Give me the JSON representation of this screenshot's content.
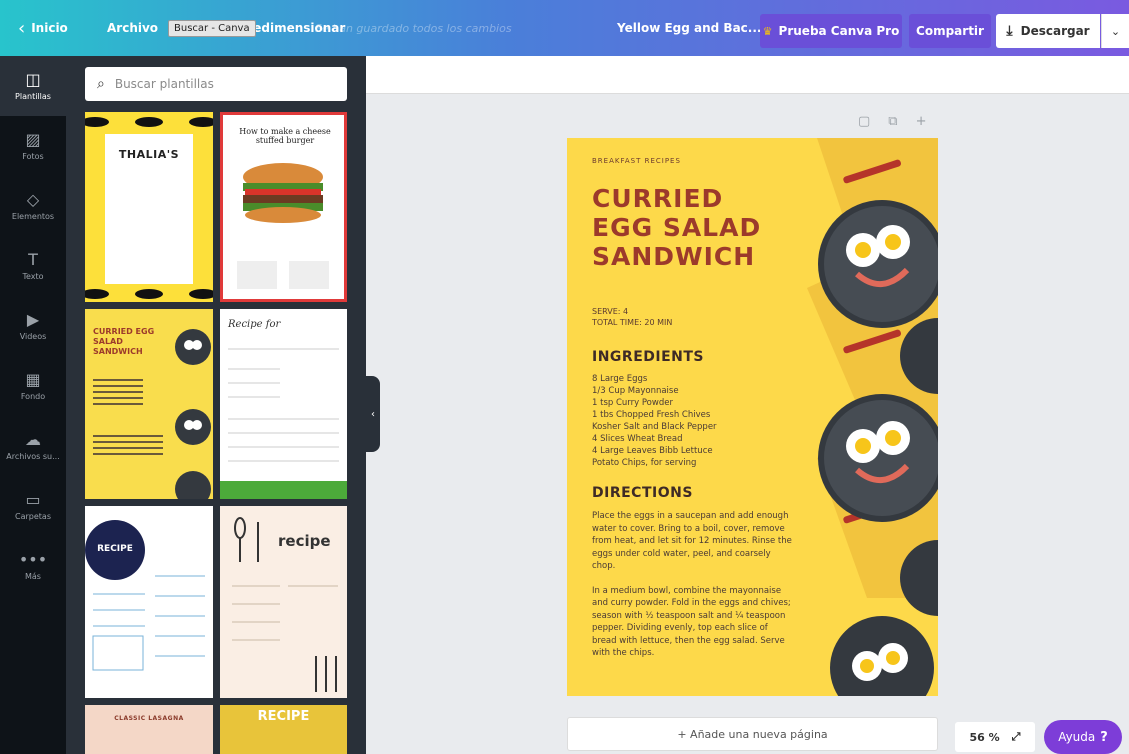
{
  "topbar": {
    "home": "Inicio",
    "file": "Archivo",
    "resize": "Redimensionar",
    "tooltip": "Buscar - Canva",
    "saved": "Se han guardado todos los cambios",
    "doc_title": "Yellow Egg and Bac...",
    "pro": "Prueba Canva Pro",
    "share": "Compartir",
    "download": "Descargar"
  },
  "rail": [
    {
      "label": "Plantillas",
      "icon": "layout-icon"
    },
    {
      "label": "Fotos",
      "icon": "photo-icon"
    },
    {
      "label": "Elementos",
      "icon": "shapes-icon"
    },
    {
      "label": "Texto",
      "icon": "text-icon"
    },
    {
      "label": "Videos",
      "icon": "video-icon"
    },
    {
      "label": "Fondo",
      "icon": "background-icon"
    },
    {
      "label": "Archivos su...",
      "icon": "upload-icon"
    },
    {
      "label": "Carpetas",
      "icon": "folder-icon"
    },
    {
      "label": "Más",
      "icon": "more-icon"
    }
  ],
  "search": {
    "placeholder": "Buscar plantillas"
  },
  "templates": {
    "t1": "THALIA'S",
    "t2": "How to make a cheese stuffed burger",
    "t3": "CURRIED EGG SALAD SANDWICH",
    "t4": "Recipe for",
    "t5": "RECIPE",
    "t6": "recipe",
    "t7": "CLASSIC LASAGNA",
    "t8": "RECIPE"
  },
  "page": {
    "kicker": "BREAKFAST RECIPES",
    "title": "CURRIED EGG SALAD SANDWICH",
    "serve": "SERVE: 4",
    "time": "TOTAL TIME: 20 MIN",
    "ingredients_heading": "INGREDIENTS",
    "ingredients": [
      "8 Large Eggs",
      "1/3 Cup Mayonnaise",
      "1 tsp Curry Powder",
      "1 tbs Chopped Fresh Chives",
      "Kosher Salt and Black Pepper",
      "4 Slices Wheat Bread",
      "4 Large Leaves Bibb Lettuce",
      "Potato Chips, for serving"
    ],
    "directions_heading": "DIRECTIONS",
    "directions_1": "Place the eggs in a saucepan and add enough water to cover. Bring to a boil, cover, remove from heat, and let sit for 12 minutes. Rinse the eggs under cold water, peel, and coarsely chop.",
    "directions_2": "In a medium bowl, combine the mayonnaise and curry powder. Fold in the eggs and chives; season with ½ teaspoon salt and ¼ teaspoon pepper. Dividing evenly, top each slice of bread with lettuce, then the egg salad. Serve with the chips."
  },
  "footer": {
    "add_page": "+ Añade una nueva página",
    "zoom": "56 %",
    "help": "Ayuda",
    "help_mark": "?"
  },
  "colors": {
    "page_bg": "#fdd94a",
    "title": "#9c3a2b",
    "pro_button": "#6a4fd8",
    "help_button": "#7d3dd8"
  }
}
